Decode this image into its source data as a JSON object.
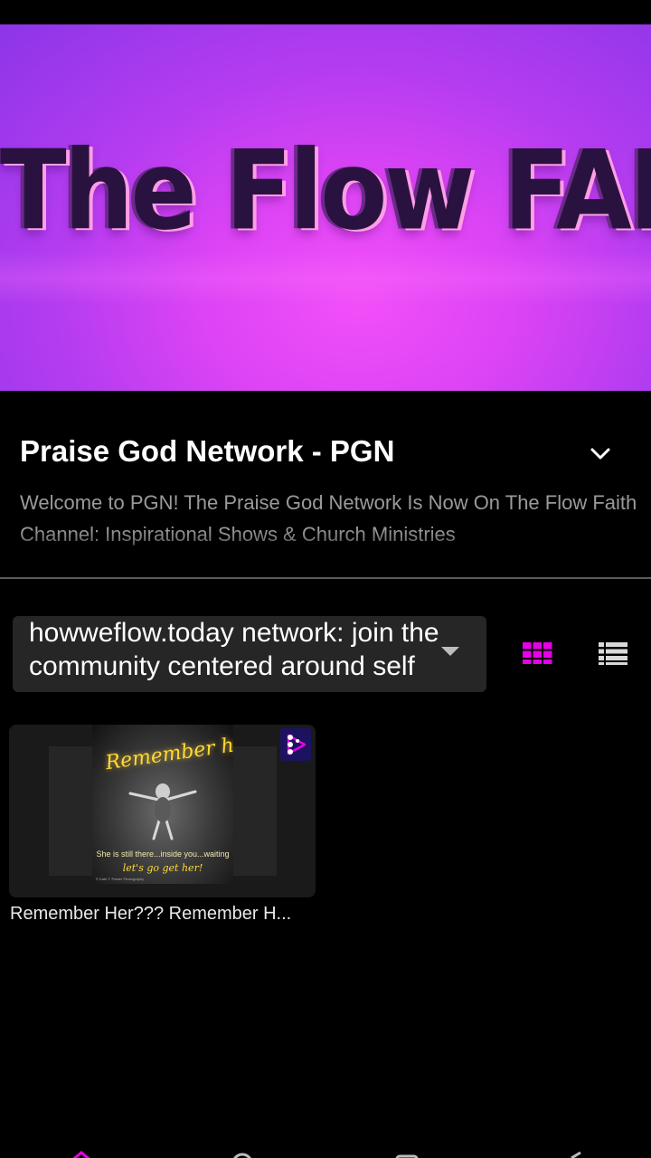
{
  "hero": {
    "title": "The Flow FAITH"
  },
  "channel": {
    "title": "Praise God Network - PGN",
    "description": "Welcome to PGN! The Praise God Network Is Now On The Flow Faith Channel: Inspirational Shows & Church Ministries",
    "expand_icon": "chevron-down-icon"
  },
  "network_select": {
    "value": "howweflow.today network: join the community centered around self"
  },
  "view_toggle": {
    "grid_icon": "grid-icon",
    "list_icon": "list-icon",
    "active": "grid",
    "active_color": "#e600e6"
  },
  "videos": [
    {
      "title": "Remember Her???  Remember H...",
      "thumbnail": {
        "headline": "Remember her?",
        "caption": "She is still there...inside you...waiting",
        "caption2": "let's go get her!",
        "credit": "© Kate T. Parker Photography"
      },
      "badge_icon": "play-logo-icon"
    }
  ],
  "bottom_nav": [
    {
      "icon": "home-icon",
      "active": true
    },
    {
      "icon": "search-icon",
      "active": false
    },
    {
      "icon": "library-icon",
      "active": false
    },
    {
      "icon": "settings-icon",
      "active": false
    }
  ],
  "colors": {
    "accent": "#e600e6",
    "background": "#000000",
    "hero_purple": "#c040f2"
  }
}
